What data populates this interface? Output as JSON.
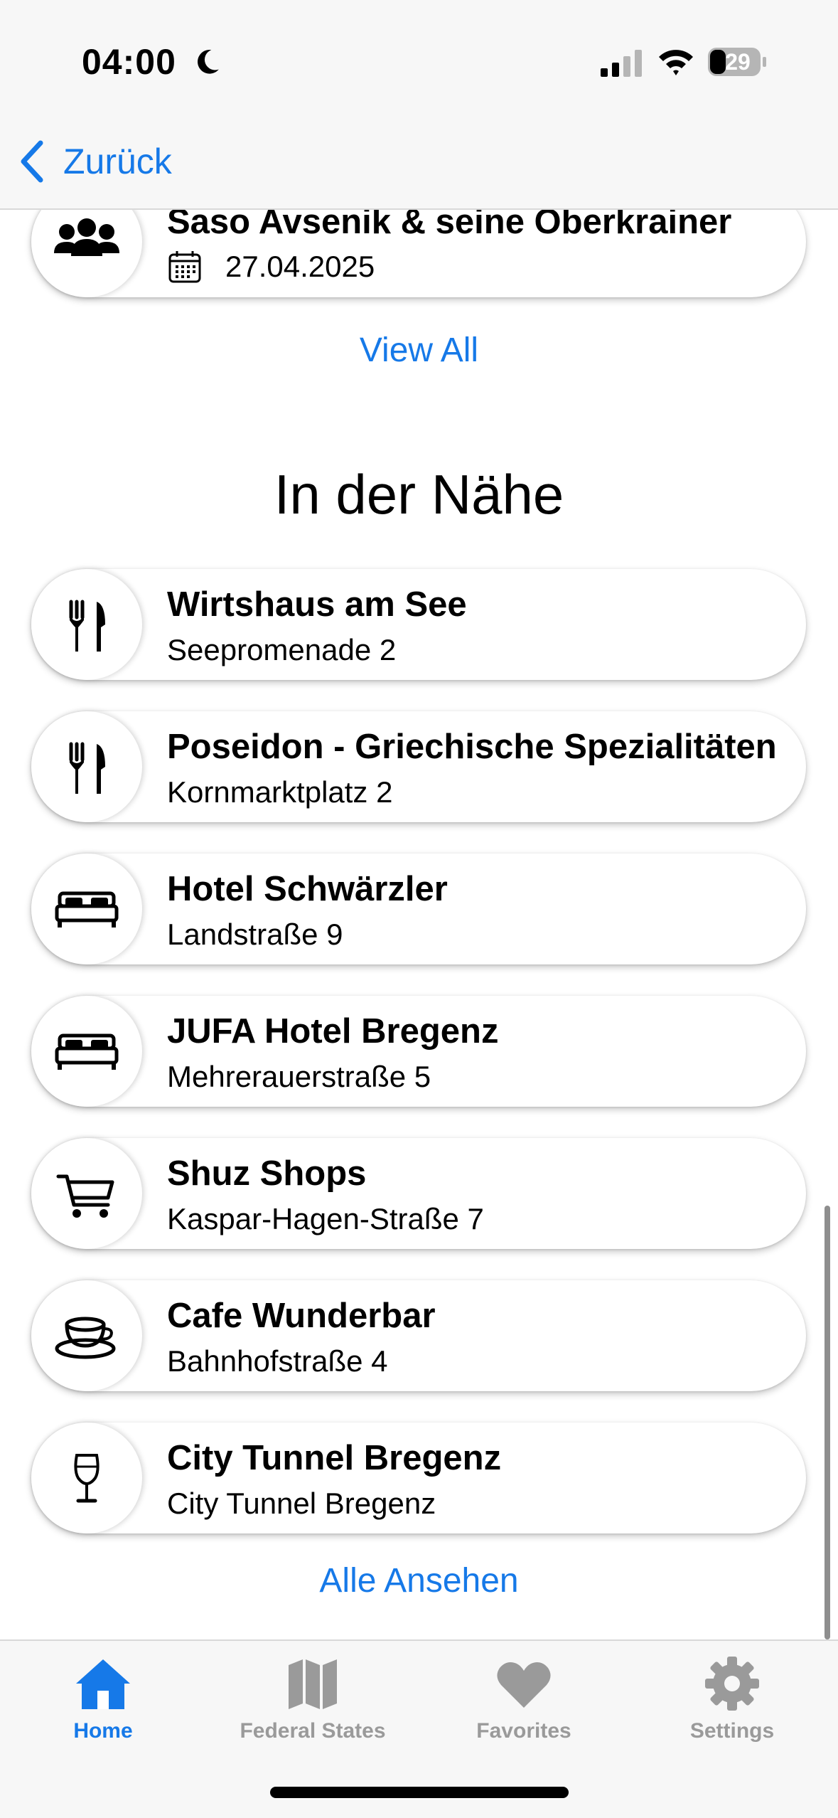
{
  "status_bar": {
    "time": "04:00",
    "battery": "29"
  },
  "nav": {
    "back_label": "Zurück"
  },
  "events": {
    "items": [
      {
        "title": "Saso Avsenik & seine Oberkrainer",
        "date": "27.04.2025",
        "icon": "group-icon"
      }
    ],
    "view_all_label": "View All"
  },
  "nearby": {
    "title": "In der Nähe",
    "items": [
      {
        "title": "Wirtshaus am See",
        "address": "Seepromenade 2",
        "icon": "fork-knife-icon"
      },
      {
        "title": "Poseidon - Griechische Spezialitäten",
        "address": "Kornmarktplatz 2",
        "icon": "fork-knife-icon"
      },
      {
        "title": "Hotel Schwärzler",
        "address": "Landstraße 9",
        "icon": "bed-icon"
      },
      {
        "title": "JUFA Hotel Bregenz",
        "address": "Mehrerauerstraße 5",
        "icon": "bed-icon"
      },
      {
        "title": "Shuz Shops",
        "address": "Kaspar-Hagen-Straße 7",
        "icon": "cart-icon"
      },
      {
        "title": "Cafe Wunderbar",
        "address": "Bahnhofstraße 4",
        "icon": "coffee-cup-icon"
      },
      {
        "title": "City Tunnel Bregenz",
        "address": "City Tunnel Bregenz",
        "icon": "wine-glass-icon"
      }
    ],
    "view_all_label": "Alle Ansehen"
  },
  "tabbar": {
    "tabs": [
      {
        "label": "Home",
        "icon": "house-icon",
        "active": true
      },
      {
        "label": "Federal States",
        "icon": "map-icon",
        "active": false
      },
      {
        "label": "Favorites",
        "icon": "heart-icon",
        "active": false
      },
      {
        "label": "Settings",
        "icon": "gear-icon",
        "active": false
      }
    ]
  },
  "colors": {
    "accent": "#1679e8",
    "inactive_tab": "#9a9a9a",
    "bar_background": "#f7f7f7"
  }
}
